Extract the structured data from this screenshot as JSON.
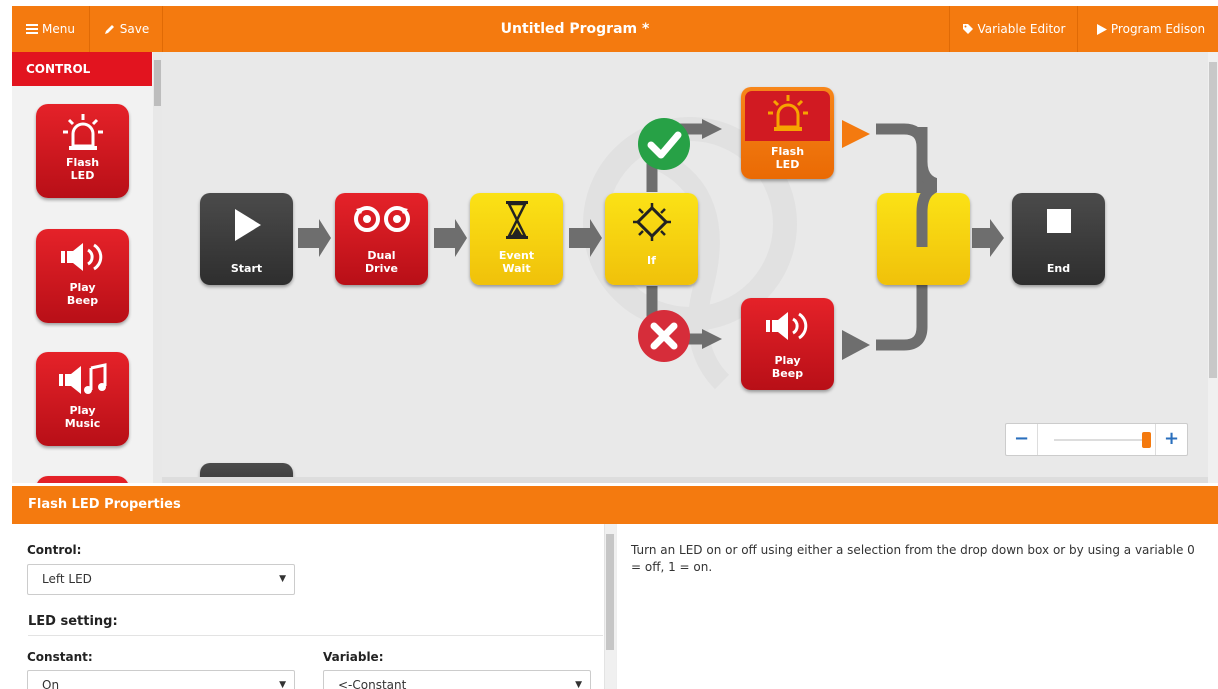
{
  "topbar": {
    "menu_label": "Menu",
    "save_label": "Save",
    "title": "Untitled Program *",
    "variable_editor_label": "Variable Editor",
    "program_label": "Program Edison"
  },
  "palette": {
    "header": "CONTROL",
    "items": [
      {
        "label": "Flash LED",
        "icon": "alarm-light-icon"
      },
      {
        "label": "Play Beep",
        "icon": "speaker-icon"
      },
      {
        "label": "Play Music",
        "icon": "music-icon"
      }
    ]
  },
  "canvas": {
    "blocks": {
      "start": "Start",
      "dual_drive": "Dual Drive",
      "event_wait": "Event Wait",
      "if": "If",
      "flash_led": "Flash LED",
      "play_beep": "Play Beep",
      "end": "End"
    },
    "zoom": {
      "minus": "−",
      "plus": "+",
      "level": 0.97
    }
  },
  "properties": {
    "title": "Flash LED Properties",
    "control_label": "Control:",
    "control_value": "Left LED",
    "led_setting_label": "LED setting:",
    "constant_label": "Constant:",
    "constant_value": "On",
    "variable_label": "Variable:",
    "variable_value": "<-Constant",
    "help": "Turn an LED on or off using either a selection from the drop down box or by using a variable 0 = off, 1 = on."
  },
  "colors": {
    "accent_orange": "#f47a0f",
    "block_red": "#d41a22",
    "block_yellow": "#f7d00f",
    "block_dark": "#3a3a3a",
    "canvas_bg": "#e9e9e9",
    "check_green": "#27a146",
    "cross_red": "#d62d3a"
  }
}
